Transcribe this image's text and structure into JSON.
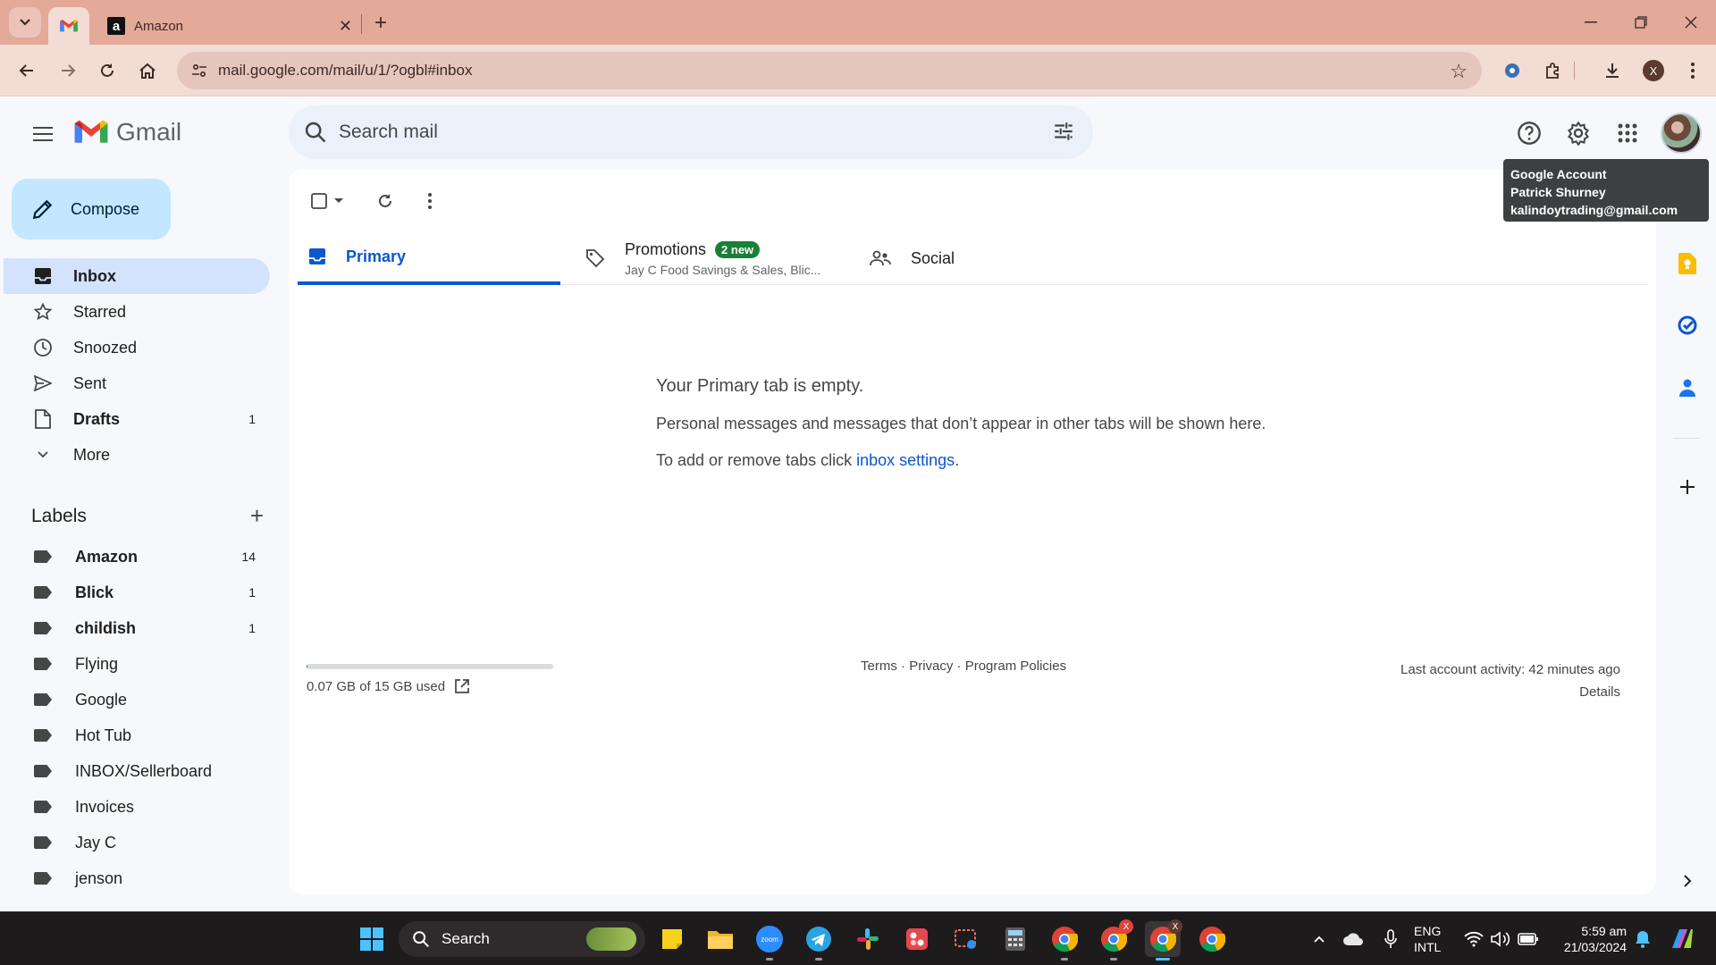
{
  "browser": {
    "tabs": [
      {
        "title": "",
        "favicon": "gmail-icon",
        "active": true
      },
      {
        "title": "Amazon",
        "favicon": "amazon-icon",
        "active": false
      }
    ],
    "url": "mail.google.com/mail/u/1/?ogbl#inbox",
    "profile_initial": "X"
  },
  "gmail": {
    "logo_text": "Gmail",
    "search_placeholder": "Search mail",
    "tooltip": {
      "title": "Google Account",
      "name": "Patrick Shurney",
      "email": "kalindoytrading@gmail.com"
    },
    "compose_label": "Compose",
    "nav": [
      {
        "label": "Inbox",
        "count": "",
        "icon": "inbox-icon",
        "active": true,
        "bold": true
      },
      {
        "label": "Starred",
        "count": "",
        "icon": "star-icon",
        "active": false,
        "bold": false
      },
      {
        "label": "Snoozed",
        "count": "",
        "icon": "clock-icon",
        "active": false,
        "bold": false
      },
      {
        "label": "Sent",
        "count": "",
        "icon": "send-icon",
        "active": false,
        "bold": false
      },
      {
        "label": "Drafts",
        "count": "1",
        "icon": "draft-icon",
        "active": false,
        "bold": true
      },
      {
        "label": "More",
        "count": "",
        "icon": "chevron-down-icon",
        "active": false,
        "bold": false
      }
    ],
    "labels_header": "Labels",
    "labels": [
      {
        "label": "Amazon",
        "count": "14",
        "bold": true
      },
      {
        "label": "Blick",
        "count": "1",
        "bold": true
      },
      {
        "label": "childish",
        "count": "1",
        "bold": true
      },
      {
        "label": "Flying",
        "count": "",
        "bold": false
      },
      {
        "label": "Google",
        "count": "",
        "bold": false
      },
      {
        "label": "Hot Tub",
        "count": "",
        "bold": false
      },
      {
        "label": "INBOX/Sellerboard",
        "count": "",
        "bold": false
      },
      {
        "label": "Invoices",
        "count": "",
        "bold": false
      },
      {
        "label": "Jay C",
        "count": "",
        "bold": false
      },
      {
        "label": "jenson",
        "count": "",
        "bold": false
      }
    ],
    "inbox_tabs": {
      "primary": "Primary",
      "promotions": "Promotions",
      "promotions_badge": "2 new",
      "promotions_snippet": "Jay C Food Savings & Sales, Blic...",
      "social": "Social"
    },
    "empty_state": {
      "title": "Your Primary tab is empty.",
      "line1": "Personal messages and messages that don’t appear in other tabs will be shown here.",
      "line2_prefix": "To add or remove tabs click ",
      "line2_link": "inbox settings",
      "line2_suffix": "."
    },
    "footer": {
      "storage_text": "0.07 GB of 15 GB used",
      "storage_fraction": 0.005,
      "terms": "Terms",
      "privacy": "Privacy",
      "policies": "Program Policies",
      "separator": " · ",
      "last_activity": "Last account activity: 42 minutes ago",
      "details": "Details"
    }
  },
  "taskbar": {
    "search_label": "Search",
    "lang_line1": "ENG",
    "lang_line2": "INTL",
    "time": "5:59 am",
    "date": "21/03/2024"
  }
}
